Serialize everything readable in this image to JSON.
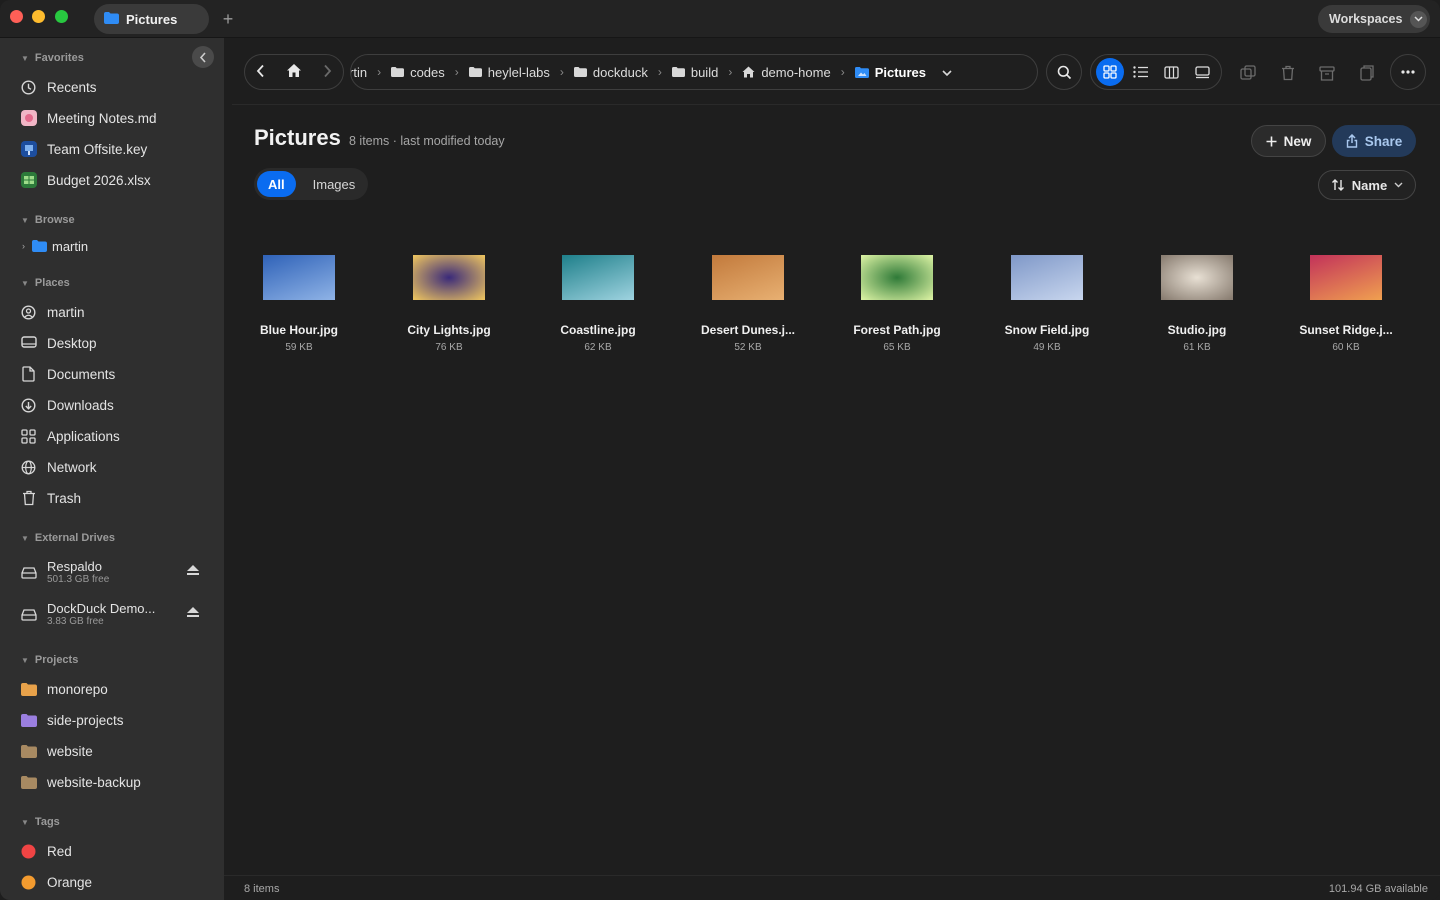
{
  "window": {
    "tab_label": "Pictures",
    "new_tab": "+",
    "workspaces_label": "Workspaces"
  },
  "sidebar": {
    "favorites_title": "Favorites",
    "favorites": [
      {
        "label": "Recents",
        "icon": "clock-icon"
      },
      {
        "label": "Meeting Notes.md",
        "icon": "markdown-file-icon"
      },
      {
        "label": "Team Offsite.key",
        "icon": "keynote-file-icon"
      },
      {
        "label": "Budget 2026.xlsx",
        "icon": "spreadsheet-file-icon"
      }
    ],
    "browse_title": "Browse",
    "browse_item": "martin",
    "places_title": "Places",
    "places": [
      {
        "label": "martin",
        "icon": "user-icon"
      },
      {
        "label": "Desktop",
        "icon": "desktop-icon"
      },
      {
        "label": "Documents",
        "icon": "document-icon"
      },
      {
        "label": "Downloads",
        "icon": "download-icon"
      },
      {
        "label": "Applications",
        "icon": "applications-icon"
      },
      {
        "label": "Network",
        "icon": "globe-icon"
      },
      {
        "label": "Trash",
        "icon": "trash-icon"
      }
    ],
    "drives_title": "External Drives",
    "drives": [
      {
        "name": "Respaldo",
        "free": "501.3 GB free"
      },
      {
        "name": "DockDuck Demo...",
        "free": "3.83 GB free"
      }
    ],
    "projects_title": "Projects",
    "projects": [
      {
        "label": "monorepo",
        "color": "#e8a24a"
      },
      {
        "label": "side-projects",
        "color": "#9b7fe0"
      },
      {
        "label": "website",
        "color": "#a88a62"
      },
      {
        "label": "website-backup",
        "color": "#a88a62"
      }
    ],
    "tags_title": "Tags",
    "tags": [
      {
        "label": "Red",
        "color": "#f04444"
      },
      {
        "label": "Orange",
        "color": "#f39b2f"
      }
    ]
  },
  "breadcrumb": {
    "items": [
      {
        "label": "rtin",
        "icon": "none"
      },
      {
        "label": "codes",
        "icon": "folder-icon"
      },
      {
        "label": "heylel-labs",
        "icon": "folder-icon"
      },
      {
        "label": "dockduck",
        "icon": "folder-icon"
      },
      {
        "label": "build",
        "icon": "folder-icon"
      },
      {
        "label": "demo-home",
        "icon": "home-icon"
      },
      {
        "label": "Pictures",
        "icon": "pictures-folder-icon"
      }
    ]
  },
  "header": {
    "title": "Pictures",
    "meta": "8 items · last modified today",
    "new_label": "New",
    "share_label": "Share"
  },
  "filters": {
    "all": "All",
    "images": "Images"
  },
  "sort": {
    "label": "Name"
  },
  "files": [
    {
      "name": "Blue Hour.jpg",
      "size": "59 KB",
      "c1": "#2f62b8",
      "c2": "#8fb3e6"
    },
    {
      "name": "City Lights.jpg",
      "size": "76 KB",
      "c1": "#3a2a7a",
      "c2": "#e8c060"
    },
    {
      "name": "Coastline.jpg",
      "size": "62 KB",
      "c1": "#1e7f8a",
      "c2": "#9fd3e0"
    },
    {
      "name": "Desert Dunes.j...",
      "size": "52 KB",
      "c1": "#c27a3c",
      "c2": "#e8b072"
    },
    {
      "name": "Forest Path.jpg",
      "size": "65 KB",
      "c1": "#2f7a38",
      "c2": "#d6eea0"
    },
    {
      "name": "Snow Field.jpg",
      "size": "49 KB",
      "c1": "#7f98c8",
      "c2": "#c8d6ee"
    },
    {
      "name": "Studio.jpg",
      "size": "61 KB",
      "c1": "#e8e0d4",
      "c2": "#8a7e72"
    },
    {
      "name": "Sunset Ridge.j...",
      "size": "60 KB",
      "c1": "#c2325a",
      "c2": "#f0a050"
    }
  ],
  "status": {
    "items": "8 items",
    "available": "101.94 GB available"
  },
  "colors": {
    "accent": "#0a6cf0"
  }
}
